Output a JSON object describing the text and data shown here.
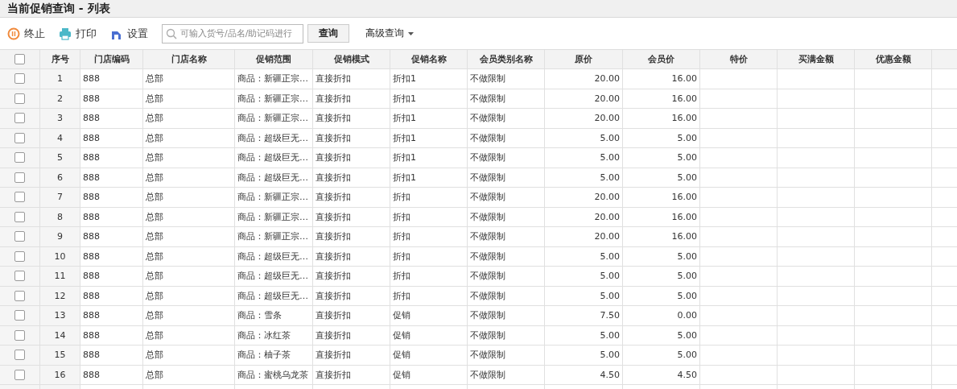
{
  "window": {
    "title": "当前促销查询 - 列表"
  },
  "toolbar": {
    "buttons": [
      {
        "kind": "stop",
        "label": "终止"
      },
      {
        "kind": "print",
        "label": "打印"
      },
      {
        "kind": "settings",
        "label": "设置"
      }
    ],
    "search": {
      "placeholder": "可输入货号/品名/助记码进行"
    },
    "query_button": "查询",
    "advanced": "高级查询"
  },
  "table": {
    "select_all": {
      "checked": false
    },
    "columns": [
      "序号",
      "门店编码",
      "门店名称",
      "促销范围",
      "促销模式",
      "促销名称",
      "会员类别名称",
      "原价",
      "会员价",
      "特价",
      "买满金额",
      "优惠金额"
    ],
    "rows": [
      {
        "checked": false,
        "cells": [
          "1",
          "888",
          "总部",
          "商品：新疆正宗…",
          "直接折扣",
          "折扣1",
          "不做限制",
          "20.00",
          "16.00"
        ]
      },
      {
        "checked": false,
        "cells": [
          "2",
          "888",
          "总部",
          "商品：新疆正宗…",
          "直接折扣",
          "折扣1",
          "不做限制",
          "20.00",
          "16.00"
        ]
      },
      {
        "checked": false,
        "cells": [
          "3",
          "888",
          "总部",
          "商品：新疆正宗…",
          "直接折扣",
          "折扣1",
          "不做限制",
          "20.00",
          "16.00"
        ]
      },
      {
        "checked": false,
        "cells": [
          "4",
          "888",
          "总部",
          "商品：超级巨无…",
          "直接折扣",
          "折扣1",
          "不做限制",
          "5.00",
          "5.00"
        ]
      },
      {
        "checked": false,
        "cells": [
          "5",
          "888",
          "总部",
          "商品：超级巨无…",
          "直接折扣",
          "折扣1",
          "不做限制",
          "5.00",
          "5.00"
        ]
      },
      {
        "checked": false,
        "cells": [
          "6",
          "888",
          "总部",
          "商品：超级巨无…",
          "直接折扣",
          "折扣1",
          "不做限制",
          "5.00",
          "5.00"
        ]
      },
      {
        "checked": false,
        "cells": [
          "7",
          "888",
          "总部",
          "商品：新疆正宗…",
          "直接折扣",
          "折扣",
          "不做限制",
          "20.00",
          "16.00"
        ]
      },
      {
        "checked": false,
        "cells": [
          "8",
          "888",
          "总部",
          "商品：新疆正宗…",
          "直接折扣",
          "折扣",
          "不做限制",
          "20.00",
          "16.00"
        ]
      },
      {
        "checked": false,
        "cells": [
          "9",
          "888",
          "总部",
          "商品：新疆正宗…",
          "直接折扣",
          "折扣",
          "不做限制",
          "20.00",
          "16.00"
        ]
      },
      {
        "checked": false,
        "cells": [
          "10",
          "888",
          "总部",
          "商品：超级巨无…",
          "直接折扣",
          "折扣",
          "不做限制",
          "5.00",
          "5.00"
        ]
      },
      {
        "checked": false,
        "cells": [
          "11",
          "888",
          "总部",
          "商品：超级巨无…",
          "直接折扣",
          "折扣",
          "不做限制",
          "5.00",
          "5.00"
        ]
      },
      {
        "checked": false,
        "cells": [
          "12",
          "888",
          "总部",
          "商品：超级巨无…",
          "直接折扣",
          "折扣",
          "不做限制",
          "5.00",
          "5.00"
        ]
      },
      {
        "checked": false,
        "cells": [
          "13",
          "888",
          "总部",
          "商品：雪条",
          "直接折扣",
          "促销",
          "不做限制",
          "7.50",
          "0.00"
        ]
      },
      {
        "checked": false,
        "cells": [
          "14",
          "888",
          "总部",
          "商品：冰红茶",
          "直接折扣",
          "促销",
          "不做限制",
          "5.00",
          "5.00"
        ]
      },
      {
        "checked": false,
        "cells": [
          "15",
          "888",
          "总部",
          "商品：柚子茶",
          "直接折扣",
          "促销",
          "不做限制",
          "5.00",
          "5.00"
        ]
      },
      {
        "checked": false,
        "cells": [
          "16",
          "888",
          "总部",
          "商品：蜜桃乌龙茶",
          "直接折扣",
          "促销",
          "不做限制",
          "4.50",
          "4.50"
        ]
      }
    ]
  }
}
